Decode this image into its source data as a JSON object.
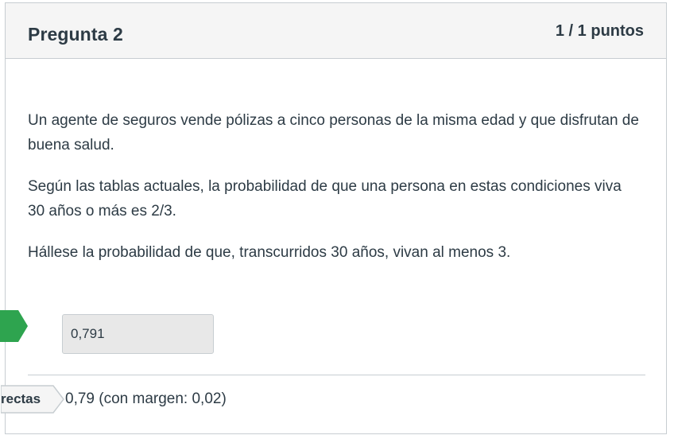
{
  "question": {
    "title": "Pregunta 2",
    "points": "1 / 1 puntos",
    "paragraphs": [
      "Un agente de seguros vende pólizas a cinco personas de la misma edad y que disfrutan de buena salud.",
      "Según las tablas actuales, la probabilidad de que una persona en estas condiciones viva 30 años o más es 2/3.",
      "Hállese la probabilidad de que, transcurridos 30 años, vivan al menos 3."
    ]
  },
  "answer": {
    "value": "0,791"
  },
  "correct_answers": {
    "label": "rectas",
    "value": "0,79 (con margen: 0,02)"
  },
  "colors": {
    "correct_marker": "#2ea44f",
    "header_bg": "#f5f5f5",
    "border": "#c7cdd1",
    "text": "#2d3b45"
  }
}
